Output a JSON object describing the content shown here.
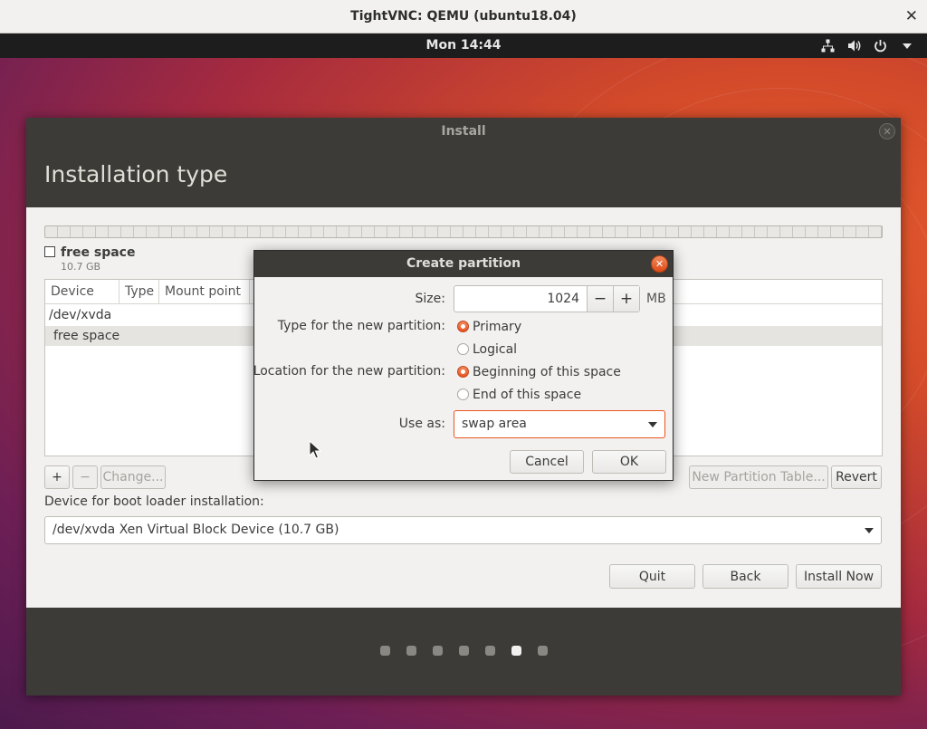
{
  "vnc": {
    "title": "TightVNC: QEMU (ubuntu18.04)",
    "close": "✕"
  },
  "panel": {
    "clock": "Mon 14:44",
    "icons": [
      "network-icon",
      "volume-icon",
      "power-icon",
      "menu-caret-icon"
    ]
  },
  "window": {
    "title": "Install",
    "close_glyph": "✕",
    "heading": "Installation type",
    "disk": {
      "legend_name": "free space",
      "legend_size": "10.7 GB"
    },
    "table": {
      "columns": [
        "Device",
        "Type",
        "Mount point"
      ],
      "rows": [
        "/dev/xvda",
        "free space"
      ]
    },
    "partition_buttons": {
      "add": "+",
      "remove": "−",
      "change": "Change..."
    },
    "new_table_button": "New Partition Table...",
    "revert_button": "Revert",
    "bootloader_label": "Device for boot loader installation:",
    "bootloader_value": "/dev/xvda Xen Virtual Block Device (10.7 GB)",
    "quit_button": "Quit",
    "back_button": "Back",
    "install_button": "Install Now",
    "progress": {
      "total_steps": 7,
      "current_step": 6
    }
  },
  "dialog": {
    "title": "Create partition",
    "close_glyph": "✕",
    "size_label": "Size:",
    "size_value": "1024",
    "size_unit": "MB",
    "minus": "−",
    "plus": "+",
    "type_label": "Type for the new partition:",
    "type_primary": "Primary",
    "type_logical": "Logical",
    "type_selected": "Primary",
    "location_label": "Location for the new partition:",
    "location_begin": "Beginning of this space",
    "location_end": "End of this space",
    "location_selected": "Beginning of this space",
    "use_as_label": "Use as:",
    "use_as_value": "swap area",
    "cancel_button": "Cancel",
    "ok_button": "OK"
  },
  "colors": {
    "accent": "#e95420",
    "header": "#3c3b37",
    "background": "#f2f1f0"
  }
}
